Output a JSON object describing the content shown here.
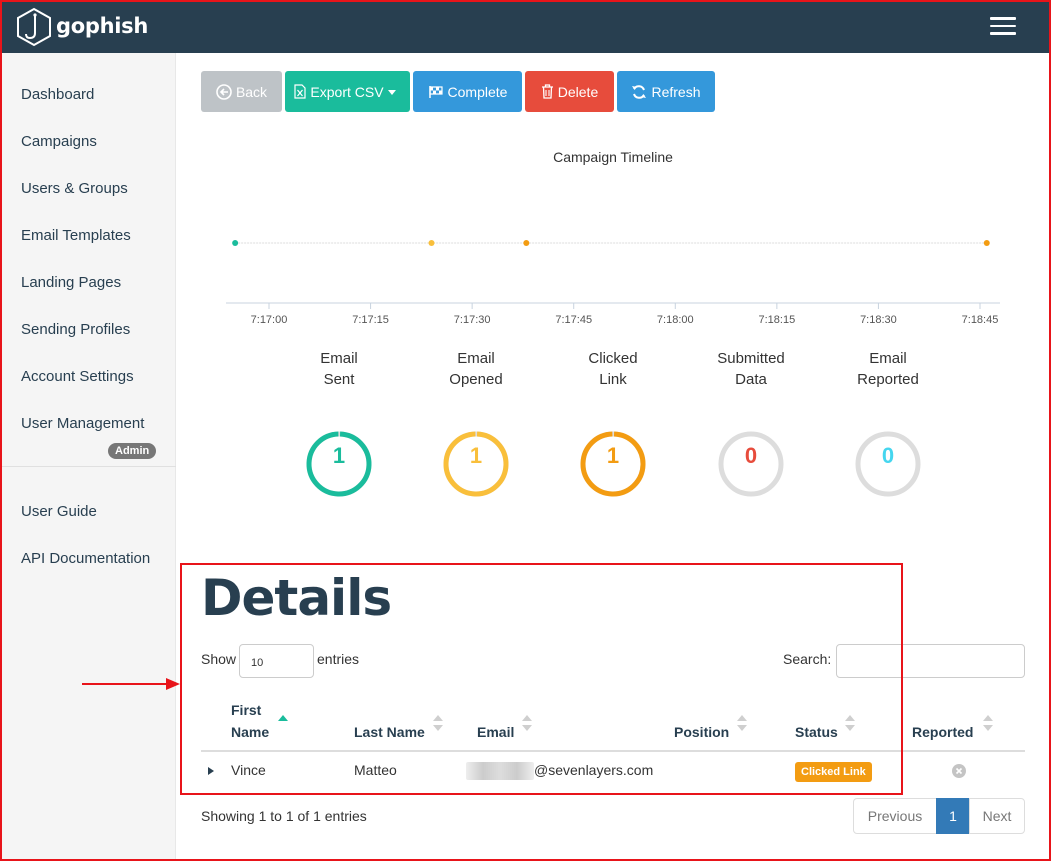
{
  "app": {
    "brand": "gophish"
  },
  "sidebar": {
    "items": [
      {
        "label": "Dashboard"
      },
      {
        "label": "Campaigns"
      },
      {
        "label": "Users & Groups"
      },
      {
        "label": "Email Templates"
      },
      {
        "label": "Landing Pages"
      },
      {
        "label": "Sending Profiles"
      },
      {
        "label": "Account Settings"
      },
      {
        "label": "User Management"
      }
    ],
    "admin_badge": "Admin",
    "bottom_items": [
      {
        "label": "User Guide"
      },
      {
        "label": "API Documentation"
      }
    ]
  },
  "toolbar": {
    "back_label": "Back",
    "export_label": "Export CSV",
    "complete_label": "Complete",
    "delete_label": "Delete",
    "refresh_label": "Refresh"
  },
  "timeline": {
    "title": "Campaign Timeline",
    "ticks": [
      "7:17:00",
      "7:17:15",
      "7:17:30",
      "7:17:45",
      "7:18:00",
      "7:18:15",
      "7:18:30",
      "7:18:45"
    ],
    "events": [
      {
        "time": "7:16:55",
        "color": "#1abc9c"
      },
      {
        "time": "7:17:24",
        "color": "#f9bf3b"
      },
      {
        "time": "7:17:38",
        "color": "#f39c12"
      },
      {
        "time": "7:18:46",
        "color": "#f39c12"
      }
    ]
  },
  "stats": [
    {
      "label_line1": "Email",
      "label_line2": "Sent",
      "value": "1",
      "fraction": 1,
      "color": "#1abc9c"
    },
    {
      "label_line1": "Email",
      "label_line2": "Opened",
      "value": "1",
      "fraction": 1,
      "color": "#f9bf3b"
    },
    {
      "label_line1": "Clicked",
      "label_line2": "Link",
      "value": "1",
      "fraction": 1,
      "color": "#f39c12"
    },
    {
      "label_line1": "Submitted",
      "label_line2": "Data",
      "value": "0",
      "fraction": 0,
      "color": "#e74c3c"
    },
    {
      "label_line1": "Email",
      "label_line2": "Reported",
      "value": "0",
      "fraction": 0,
      "color": "#45d6ef"
    }
  ],
  "details": {
    "title": "Details",
    "show_label": "Show",
    "entries_value": "10",
    "entries_label": "entries",
    "search_label": "Search:",
    "columns": {
      "first_name_1": "First",
      "first_name_2": "Name",
      "last_name": "Last Name",
      "email": "Email",
      "position": "Position",
      "status": "Status",
      "reported": "Reported"
    },
    "rows": [
      {
        "first_name": "Vince",
        "last_name": "Matteo",
        "email_domain": "@sevenlayers.com",
        "position": "",
        "status": "Clicked Link"
      }
    ],
    "showing": "Showing 1 to 1 of 1 entries",
    "pagination": {
      "previous": "Previous",
      "page": "1",
      "next": "Next"
    }
  }
}
